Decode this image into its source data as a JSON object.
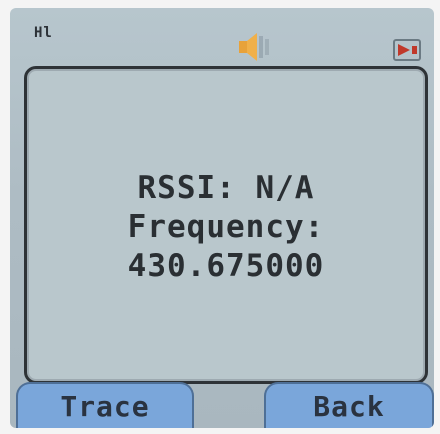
{
  "status_bar": {
    "signal_icon": "signal-indicator-icon",
    "signal_text": "Hl",
    "speaker_icon": "speaker-icon",
    "battery_icon": "battery-icon"
  },
  "message": {
    "rssi": "RSSI: N/A",
    "frequency_label": "Frequency:",
    "frequency_value": "430.675000"
  },
  "softkeys": {
    "left_label": "Trace",
    "right_label": "Back"
  },
  "colors": {
    "screen_bg": "#b7c6cd",
    "softkey_bg": "#7aa6da",
    "speaker_orange": "#e8a23a",
    "battery_red": "#c0392b",
    "text_dark": "#2a2f33"
  }
}
